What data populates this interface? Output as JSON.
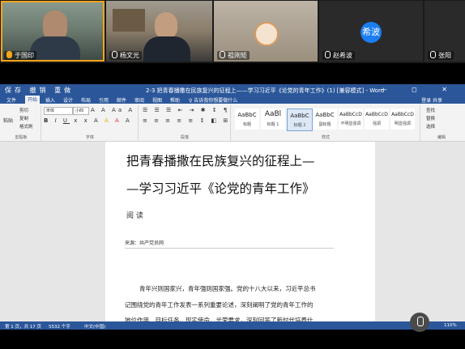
{
  "participants": [
    {
      "name": "于国印",
      "speaking": true
    },
    {
      "name": "杨文光",
      "speaking": false
    },
    {
      "name": "祖刚矩",
      "speaking": false
    },
    {
      "name": "赵希波",
      "speaking": false,
      "avatar_text": "希波"
    },
    {
      "name": "张阳"
    }
  ],
  "word": {
    "qat": "保存 撤销 重做",
    "doc_title": "2-3 把青春播撒在民族复兴的征程上——学习习近平《论党的青年工作》(1) [兼容模式] - Word",
    "window_buttons": "— ◻ ✕",
    "tabs": [
      "文件",
      "开始",
      "插入",
      "设计",
      "布局",
      "引用",
      "邮件",
      "审阅",
      "视图",
      "帮助",
      "♀ 告诉我你想要做什么"
    ],
    "login": "登录  共享",
    "ribbon": {
      "paste": "粘贴",
      "cut": "剪切",
      "copy": "复制",
      "format_painter": "格式刷",
      "clipboard_label": "剪贴板",
      "font_name": "宋体",
      "font_size": "小四",
      "font_label": "字体",
      "paragraph_label": "段落",
      "styles_label": "样式",
      "find": "查找",
      "replace": "替换",
      "select": "选择",
      "editing_label": "编辑",
      "styles": [
        {
          "sample": "AaBbC",
          "name": "标题"
        },
        {
          "sample": "AaBl",
          "name": "标题 1"
        },
        {
          "sample": "AaBbC",
          "name": "标题 2"
        },
        {
          "sample": "AaBbC",
          "name": "副标题"
        },
        {
          "sample": "AaBbCcD",
          "name": "不明显强调"
        },
        {
          "sample": "AaBbCcD",
          "name": "强调"
        },
        {
          "sample": "AaBbCcD",
          "name": "明显强调"
        }
      ]
    },
    "document": {
      "title_line1": "把青春播撒在民族复兴的征程上—",
      "title_line2": "—学习习近平《论党的青年工作》",
      "meta": "阅  读",
      "source": "来源：共产党员网",
      "paragraph_line1": "青年兴则国家兴，青年强则国家强。党的十八大以来，习近平总书",
      "paragraph_line2": "记围绕党的青年工作发表一系列重要论述，深刻阐明了党的青年工作的",
      "paragraph_line3": "地位作用、目标任务、现实使命、光荣要求，深刻回答了新时代培养什"
    },
    "status": {
      "page": "第 1 页，共 17 页",
      "words": "5532 个字",
      "language": "中文(中国)",
      "zoom": "110%"
    }
  }
}
